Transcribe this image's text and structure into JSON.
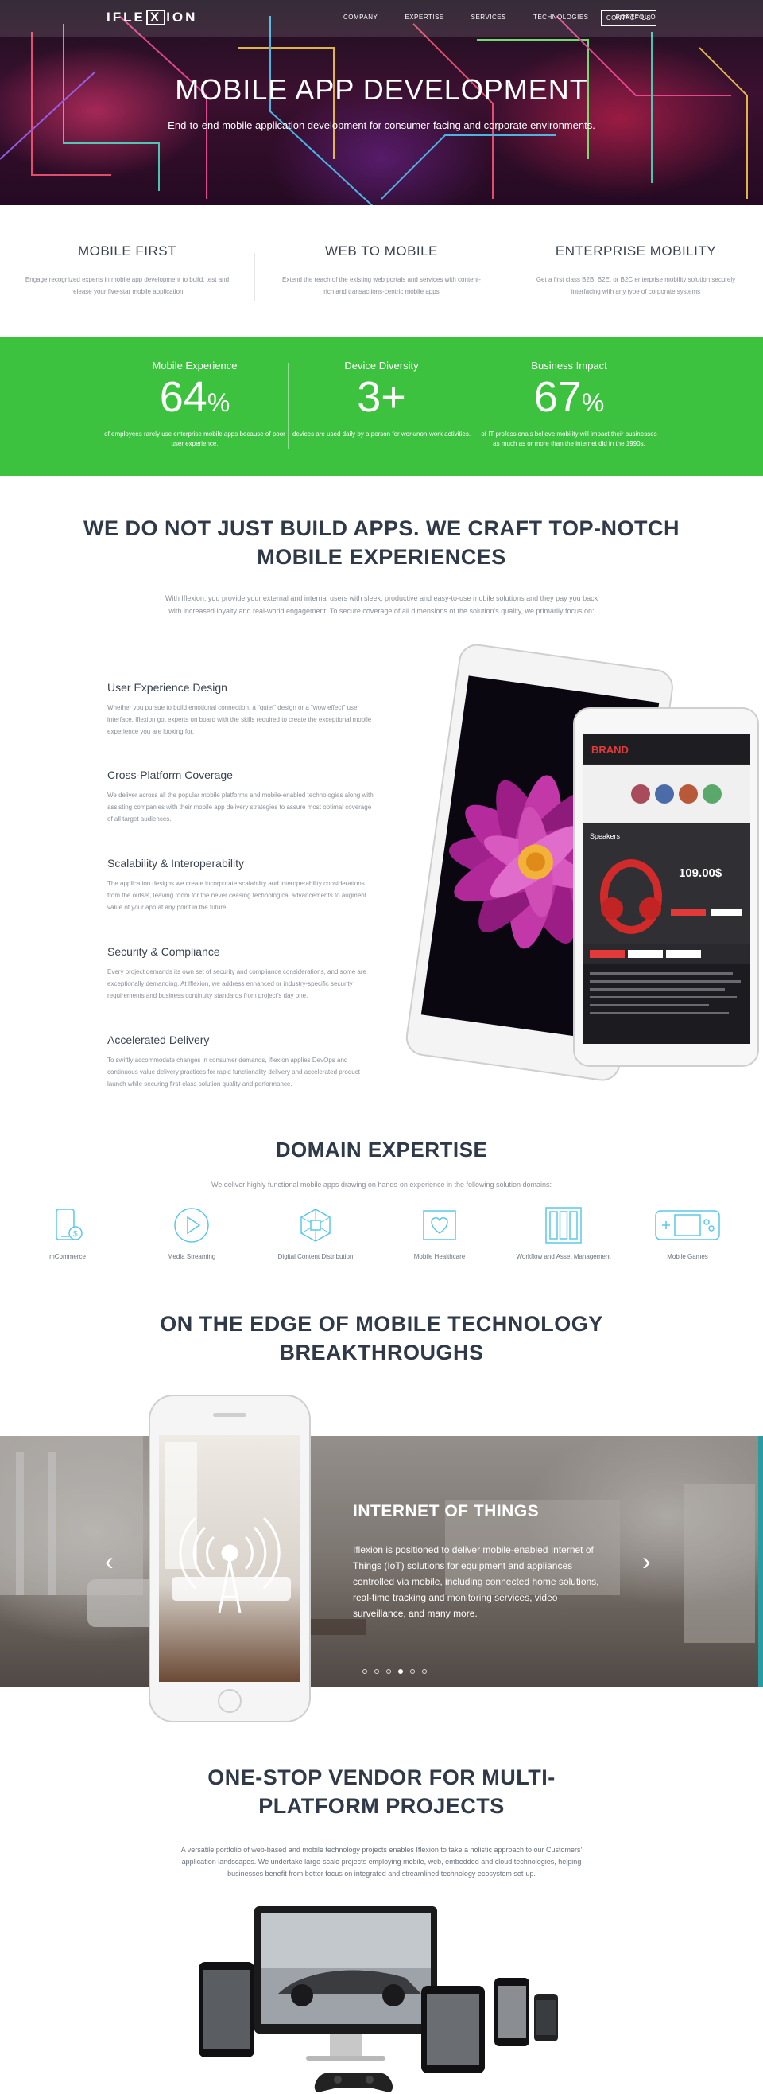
{
  "nav": {
    "logo": "IFLEXION",
    "links": [
      "COMPANY",
      "EXPERTISE",
      "SERVICES",
      "TECHNOLOGIES",
      "PORTFOLIO"
    ],
    "contact": "CONTACT US"
  },
  "hero": {
    "title": "MOBILE APP DEVELOPMENT",
    "subtitle": "End-to-end mobile application development for consumer-facing and corporate environments."
  },
  "features": [
    {
      "title": "MOBILE FIRST",
      "text": "Engage recognized experts in mobile app development to build, test and release your five-star mobile application"
    },
    {
      "title": "WEB TO MOBILE",
      "text": "Extend the reach of the existing web portals and services with content-rich and transactions-centric mobile apps"
    },
    {
      "title": "ENTERPRISE MOBILITY",
      "text": "Get a first class B2B, B2E, or B2C enterprise mobility solution securely interfacing with any type of corporate systems"
    }
  ],
  "stats": [
    {
      "label": "Mobile Experience",
      "value": "64",
      "unit": "%",
      "desc": "of employees rarely use enterprise mobile apps because of poor user experience."
    },
    {
      "label": "Device Diversity",
      "value": "3+",
      "unit": "",
      "desc": "devices are used daily by a person for work/non-work activities."
    },
    {
      "label": "Business Impact",
      "value": "67",
      "unit": "%",
      "desc": "of IT professionals believe mobility will impact their businesses as much as or more than the internet did in the 1990s."
    }
  ],
  "craft": {
    "title_line1": "WE DO NOT JUST BUILD APPS. WE CRAFT TOP-NOTCH",
    "title_line2": "MOBILE EXPERIENCES",
    "intro": "With Iflexion, you provide your external and internal users with sleek, productive and easy-to-use mobile solutions and they pay you back with increased loyalty and real-world engagement. To secure coverage of all dimensions of the solution's quality, we primarily focus on:",
    "items": [
      {
        "title": "User Experience Design",
        "text": "Whether you pursue to build emotional connection, a \"quiet\" design or a \"wow effect\" user interface, Iflexion got experts on board with the skills required to create the exceptional mobile experience you are looking for."
      },
      {
        "title": "Cross-Platform Coverage",
        "text": "We deliver across all the popular mobile platforms and mobile-enabled technologies along with assisting companies with their mobile app delivery strategies to assure most optimal coverage of all target audiences."
      },
      {
        "title": "Scalability & Interoperability",
        "text": "The application designs we create incorporate scalability and interoperability considerations from the outset, leaving room for the never ceasing technological advancements to augment value of your app at any point in the future."
      },
      {
        "title": "Security & Compliance",
        "text": "Every project demands its own set of security and compliance considerations, and some are exceptionally demanding. At Iflexion, we address enhanced or industry-specific security requirements and business continuity standards from project's day one."
      },
      {
        "title": "Accelerated Delivery",
        "text": "To swiftly accommodate changes in consumer demands, Iflexion applies DevOps and continuous value delivery practices for rapid functionality delivery and accelerated product launch while securing first-class solution quality and performance."
      }
    ]
  },
  "tablet_screen": {
    "brand": "BRAND",
    "product": "Speakers",
    "price": "109.00$"
  },
  "domain": {
    "title": "DOMAIN EXPERTISE",
    "subtitle": "We deliver highly functional mobile apps drawing on hands-on experience in the following solution domains:",
    "items": [
      {
        "label": "mCommerce",
        "icon": "mcommerce-icon"
      },
      {
        "label": "Media Streaming",
        "icon": "play-icon"
      },
      {
        "label": "Digital Content Distribution",
        "icon": "network-icon"
      },
      {
        "label": "Mobile Healthcare",
        "icon": "heart-icon"
      },
      {
        "label": "Workflow and Asset Management",
        "icon": "folders-icon"
      },
      {
        "label": "Mobile Games",
        "icon": "gamepad-icon"
      }
    ]
  },
  "edge": {
    "title_line1": "ON THE EDGE OF MOBILE TECHNOLOGY",
    "title_line2": "BREAKTHROUGHS",
    "slide_title": "INTERNET OF THINGS",
    "slide_text": "Iflexion is positioned to deliver mobile-enabled Internet of Things (IoT) solutions for equipment and appliances controlled via mobile, including connected home solutions, real-time tracking and monitoring services, video surveillance, and many more.",
    "prev": "‹",
    "next": "›",
    "dots_total": 6,
    "active_dot": 4
  },
  "vendor": {
    "title_line1": "ONE-STOP VENDOR FOR MULTI-",
    "title_line2": "PLATFORM PROJECTS",
    "text": "A versatile portfolio of web-based and mobile technology projects enables Iflexion to take a holistic approach to our Customers' application landscapes. We undertake large-scale projects employing mobile, web, embedded and cloud technologies, helping businesses benefit from better focus on integrated and streamlined technology ecosystem set-up."
  },
  "colors": {
    "accent_green": "#3cc23e",
    "icon_blue": "#5bc8e8",
    "heading": "#2f3947"
  }
}
